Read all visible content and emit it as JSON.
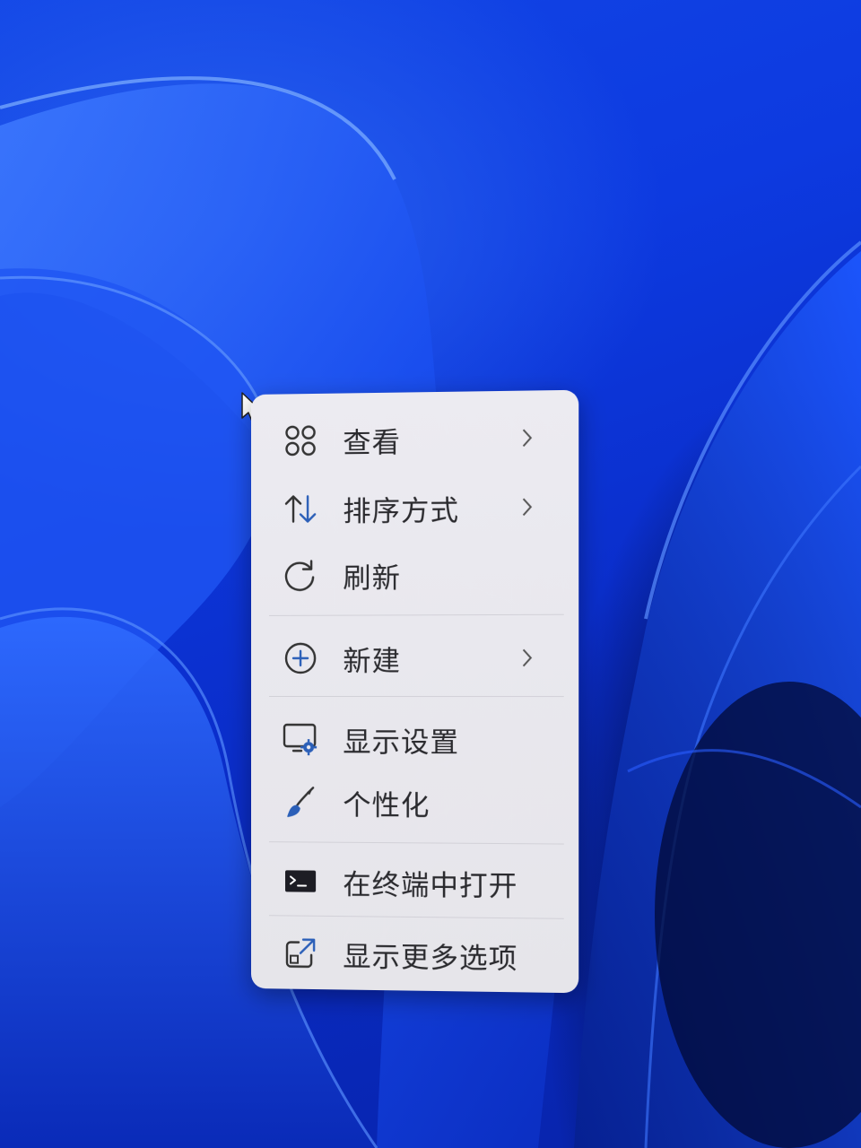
{
  "context_menu": {
    "items": [
      {
        "label": "查看",
        "icon": "grid-icon",
        "has_submenu": true
      },
      {
        "label": "排序方式",
        "icon": "sort-arrows-icon",
        "has_submenu": true
      },
      {
        "label": "刷新",
        "icon": "refresh-icon",
        "has_submenu": false
      },
      {
        "label": "新建",
        "icon": "plus-circle-icon",
        "has_submenu": true
      },
      {
        "label": "显示设置",
        "icon": "display-settings-icon",
        "has_submenu": false
      },
      {
        "label": "个性化",
        "icon": "brush-icon",
        "has_submenu": false
      },
      {
        "label": "在终端中打开",
        "icon": "terminal-icon",
        "has_submenu": false
      },
      {
        "label": "显示更多选项",
        "icon": "show-more-icon",
        "has_submenu": false
      }
    ]
  },
  "colors": {
    "wallpaper_blue": "#0a2fd0",
    "menu_background": "#eceaf0",
    "menu_text": "#2a2a2e",
    "accent_blue": "#2b5fb8"
  }
}
